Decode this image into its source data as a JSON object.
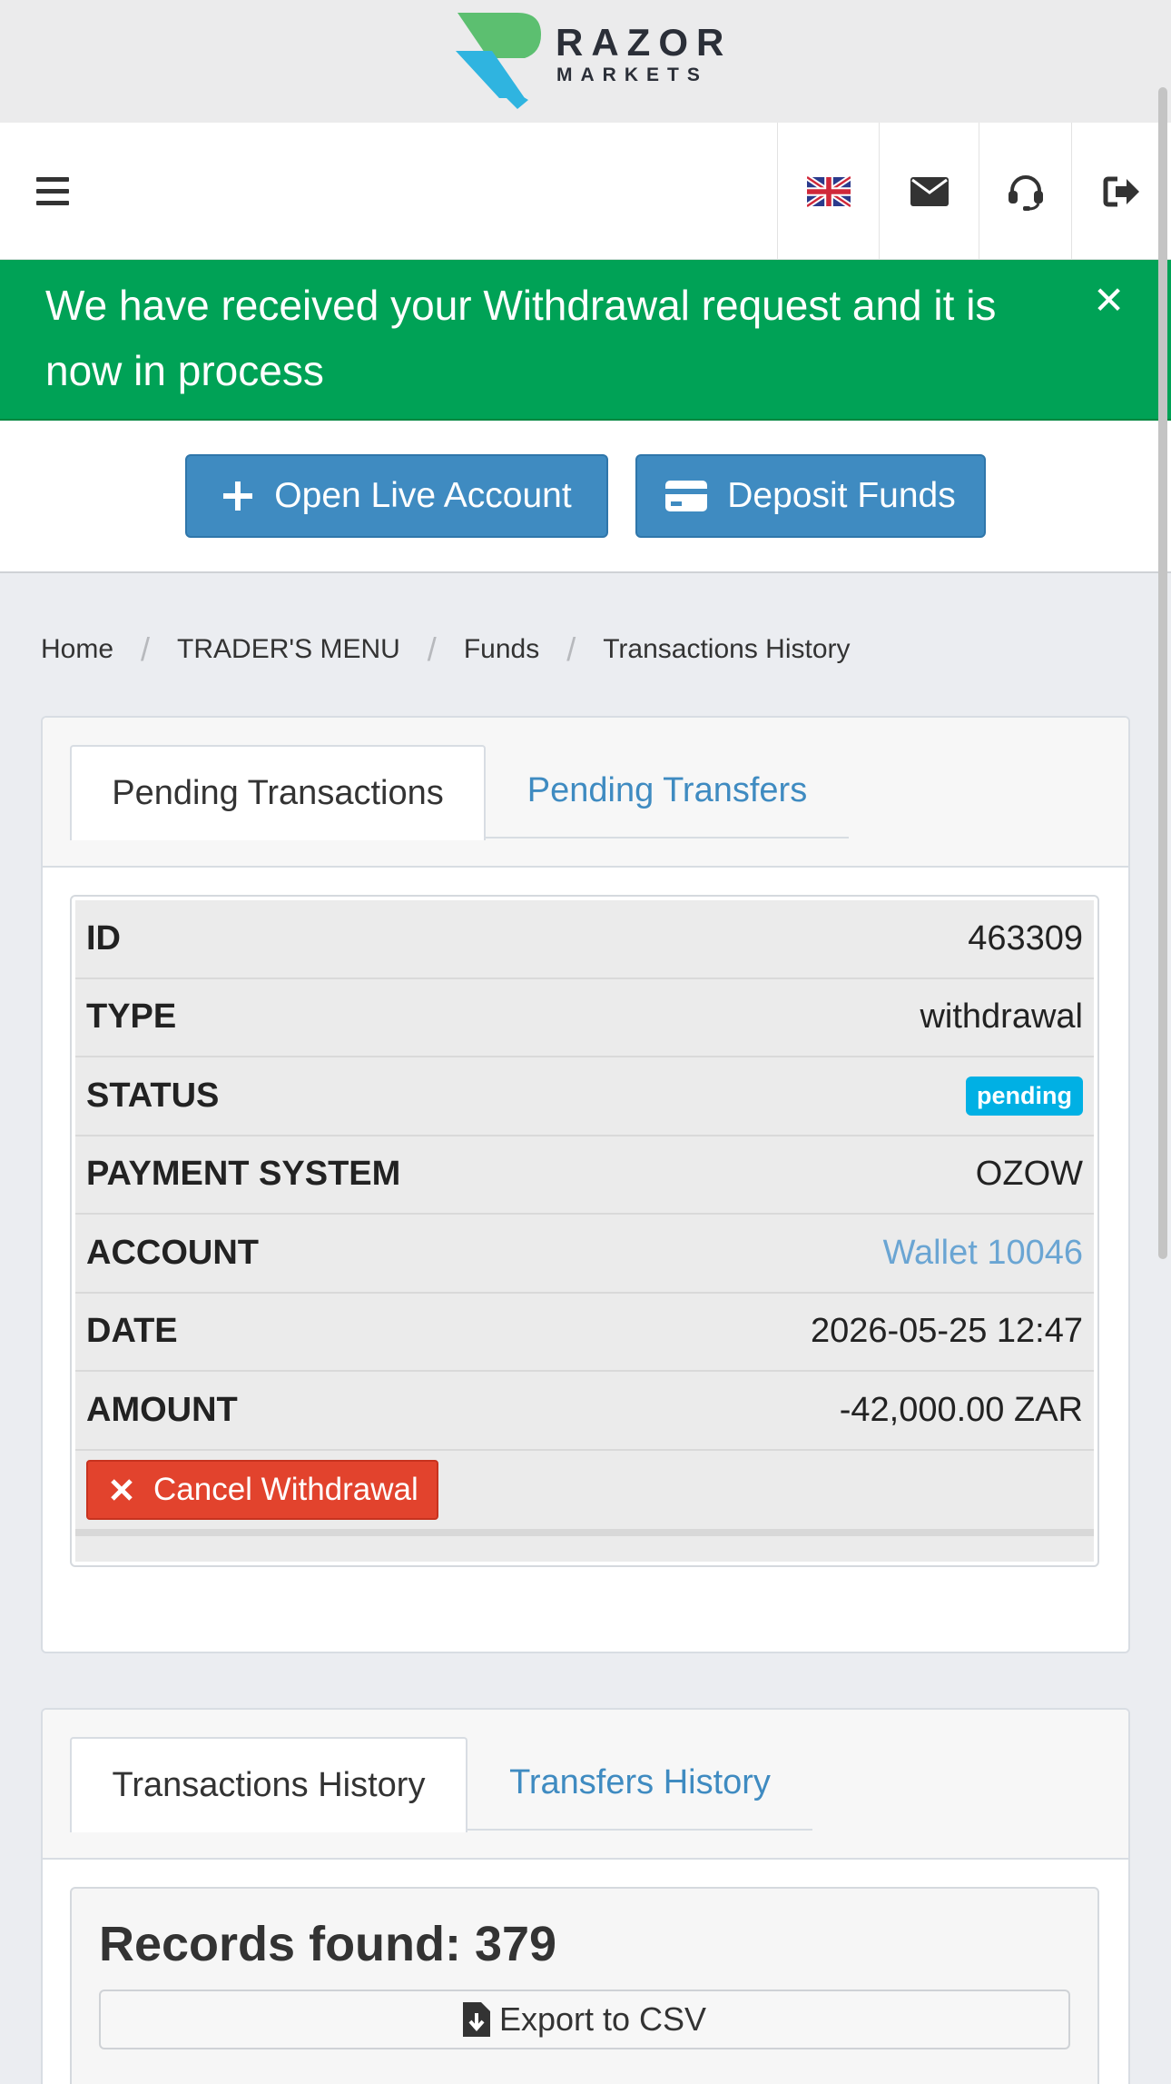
{
  "brand": {
    "name_line1": "RAZOR",
    "name_line2": "MARKETS",
    "colors": {
      "green": "#5cbf70",
      "blue": "#2fb4e0"
    }
  },
  "topnav": {
    "menu_icon": "hamburger-menu-icon",
    "icons": [
      "uk-flag-icon",
      "envelope-icon",
      "headset-icon",
      "logout-icon"
    ]
  },
  "alert": {
    "message": "We have received your Withdrawal request and it is now in process",
    "close_glyph": "✕",
    "color": "#00a256"
  },
  "actions": {
    "open_live_account": "Open Live Account",
    "deposit_funds": "Deposit Funds"
  },
  "breadcrumb": {
    "items": [
      "Home",
      "TRADER'S MENU",
      "Funds",
      "Transactions History"
    ],
    "separator": "/"
  },
  "pending_panel": {
    "tabs": [
      "Pending Transactions",
      "Pending Transfers"
    ],
    "rows": [
      {
        "label": "ID",
        "value": "463309"
      },
      {
        "label": "TYPE",
        "value": "withdrawal"
      },
      {
        "label": "STATUS",
        "value": "pending"
      },
      {
        "label": "PAYMENT SYSTEM",
        "value": "OZOW"
      },
      {
        "label": "ACCOUNT",
        "value": "Wallet 10046"
      },
      {
        "label": "DATE",
        "value": "2026-05-25 12:47"
      },
      {
        "label": "AMOUNT",
        "value": "-42,000.00 ZAR"
      }
    ],
    "cancel_button": "Cancel Withdrawal",
    "status_color": "#00b0e4"
  },
  "history_panel": {
    "tabs": [
      "Transactions History",
      "Transfers History"
    ],
    "records_found": "Records found: 379",
    "export_button": "Export to CSV"
  }
}
